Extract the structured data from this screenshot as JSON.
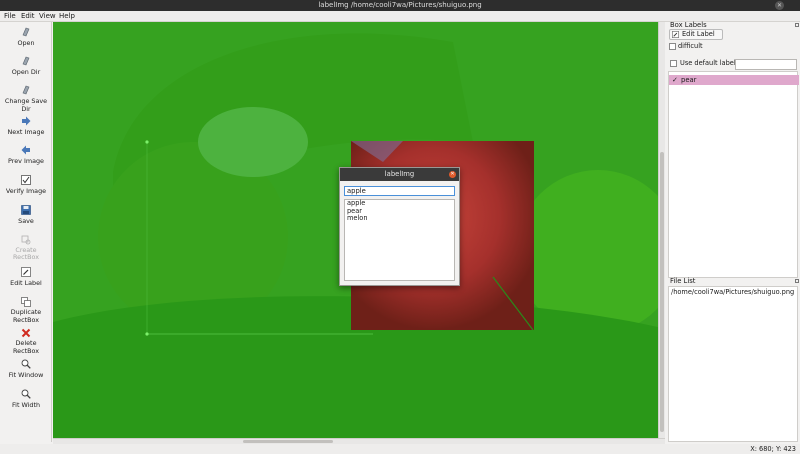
{
  "window": {
    "title": "labelImg /home/cooli7wa/Pictures/shuiguo.png"
  },
  "menu": [
    "File",
    "Edit",
    "View",
    "Help"
  ],
  "toolbar": {
    "open": "Open",
    "open_dir": "Open Dir",
    "change_save_dir": "Change Save Dir",
    "next_image": "Next Image",
    "prev_image": "Prev Image",
    "verify_image": "Verify Image",
    "save": "Save",
    "create_rectbox": "Create\nRectBox",
    "edit_label": "Edit Label",
    "duplicate_rectbox": "Duplicate\nRectBox",
    "delete_rectbox": "Delete\nRectBox",
    "fit_window": "Fit Window",
    "fit_width": "Fit Width"
  },
  "box_labels": {
    "title": "Box Labels",
    "edit_label_button": "Edit Label",
    "difficult": "difficult",
    "use_default_label": "Use default label",
    "default_label_value": "",
    "items": [
      {
        "label": "pear",
        "checked": "✓"
      }
    ]
  },
  "file_list": {
    "title": "File List",
    "items": [
      "/home/cooli7wa/Pictures/shuiguo.png"
    ]
  },
  "dialog": {
    "title": "labelImg",
    "input_value": "apple",
    "options": [
      "apple",
      "pear",
      "melon"
    ]
  },
  "status": {
    "text": "X: 680; Y: 423"
  },
  "colors": {
    "label_highlight": "#dfa8cc",
    "shape_fill": "#22aa11",
    "close_button": "#e05a2b"
  }
}
